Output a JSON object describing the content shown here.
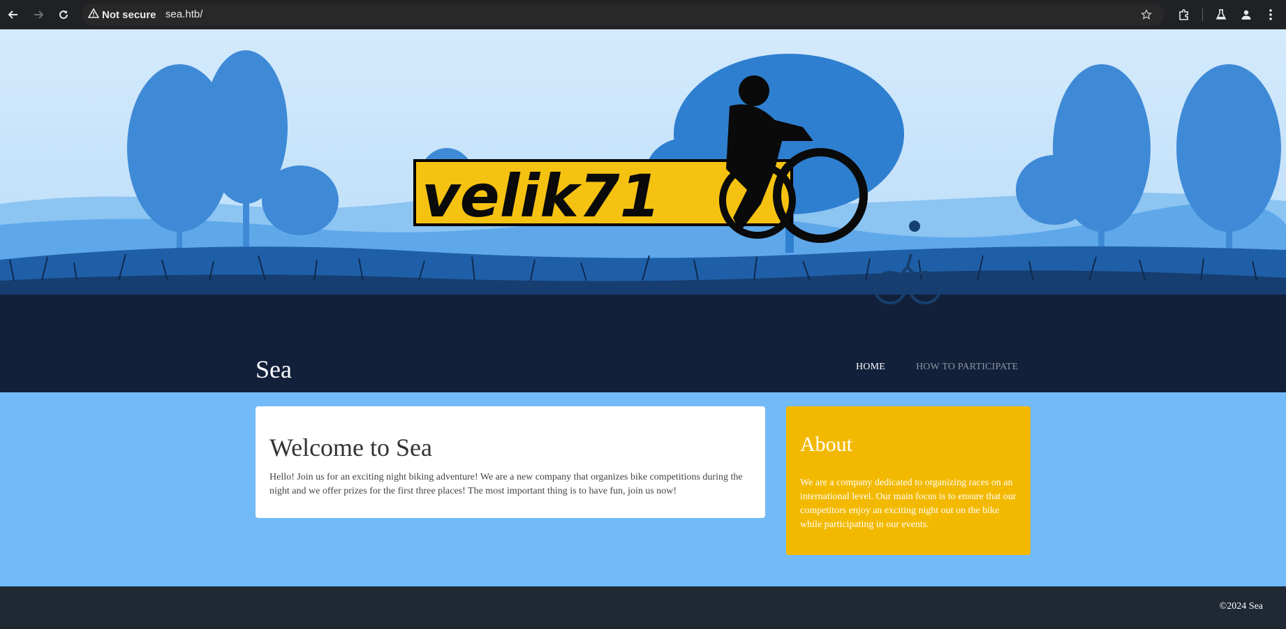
{
  "browser": {
    "security_label": "Not secure",
    "url": "sea.htb/",
    "icons": {
      "back": "arrow-left-icon",
      "forward": "arrow-right-icon",
      "reload": "reload-icon",
      "warning": "warning-icon",
      "bookmark": "star-icon",
      "extensions": "puzzle-icon",
      "labs": "flask-icon",
      "profile": "person-icon",
      "menu": "kebab-menu-icon"
    }
  },
  "hero": {
    "logo_text": "velik71"
  },
  "site": {
    "title": "Sea",
    "nav": [
      {
        "label": "HOME"
      },
      {
        "label": "HOW TO PARTICIPATE"
      }
    ]
  },
  "welcome": {
    "heading": "Welcome to Sea",
    "body": "Hello! Join us for an exciting night biking adventure! We are a new company that organizes bike competitions during the night and we offer prizes for the first three places! The most important thing is to have fun, join us now!"
  },
  "about": {
    "heading": "About",
    "body": "We are a company dedicated to organizing races on an international level. Our main focus is to ensure that our competitors enjoy an exciting night out on the bike while participating in our events."
  },
  "footer": {
    "copyright": "©2024 Sea"
  },
  "colors": {
    "sky": "#cde6fb",
    "trees": "#4a90d9",
    "night": "#12203a",
    "content_bg": "#72baf8",
    "about_bg": "#f3b900",
    "logo_bg": "#f5c211",
    "footer_bg": "#1f2833"
  }
}
